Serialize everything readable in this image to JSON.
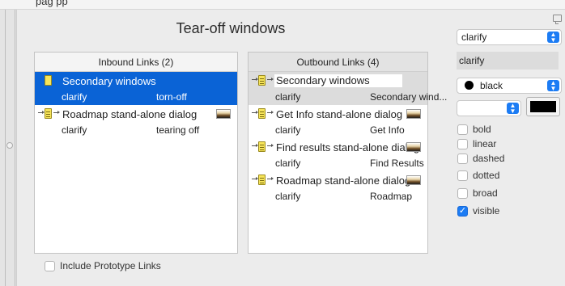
{
  "top_strip": {
    "partial_text": "pag            pp"
  },
  "window": {
    "title": "Tear-off windows"
  },
  "inbound": {
    "header": "Inbound Links (2)",
    "items": [
      {
        "name": "Secondary windows",
        "col1": "clarify",
        "col2": "torn-off",
        "selected": true,
        "icon": "note-plain-icon"
      },
      {
        "name": "Roadmap stand-alone dialog",
        "col1": "clarify",
        "col2": "tearing off",
        "icon": "note-lined-icon",
        "thumbnail": true
      }
    ]
  },
  "outbound": {
    "header": "Outbound Links (4)",
    "items": [
      {
        "name": "Secondary windows",
        "col1": "clarify",
        "col2": "Secondary wind...",
        "editing": true
      },
      {
        "name": "Get Info stand-alone dialog",
        "col1": "clarify",
        "col2": "Get Info",
        "thumbnail": true
      },
      {
        "name": "Find results stand-alone dialog",
        "col1": "clarify",
        "col2": "Find Results",
        "thumbnail": true
      },
      {
        "name": "Roadmap stand-alone dialog",
        "col1": "clarify",
        "col2": "Roadmap",
        "thumbnail": true
      }
    ]
  },
  "include_prototype": {
    "label": "Include Prototype Links",
    "checked": false
  },
  "inspector": {
    "link_type_select": "clarify",
    "link_type_readout": "clarify",
    "color_select": "black",
    "color_value": "#000000",
    "pattern_select": "",
    "options": [
      {
        "label": "bold",
        "checked": false
      },
      {
        "label": "linear",
        "checked": false
      },
      {
        "label": "dashed",
        "checked": false
      },
      {
        "label": "dotted",
        "checked": false
      },
      {
        "label": "broad",
        "checked": false
      },
      {
        "label": "visible",
        "checked": true
      }
    ]
  },
  "colors": {
    "selection": "#0a63d6",
    "accent": "#1c7cf4"
  }
}
